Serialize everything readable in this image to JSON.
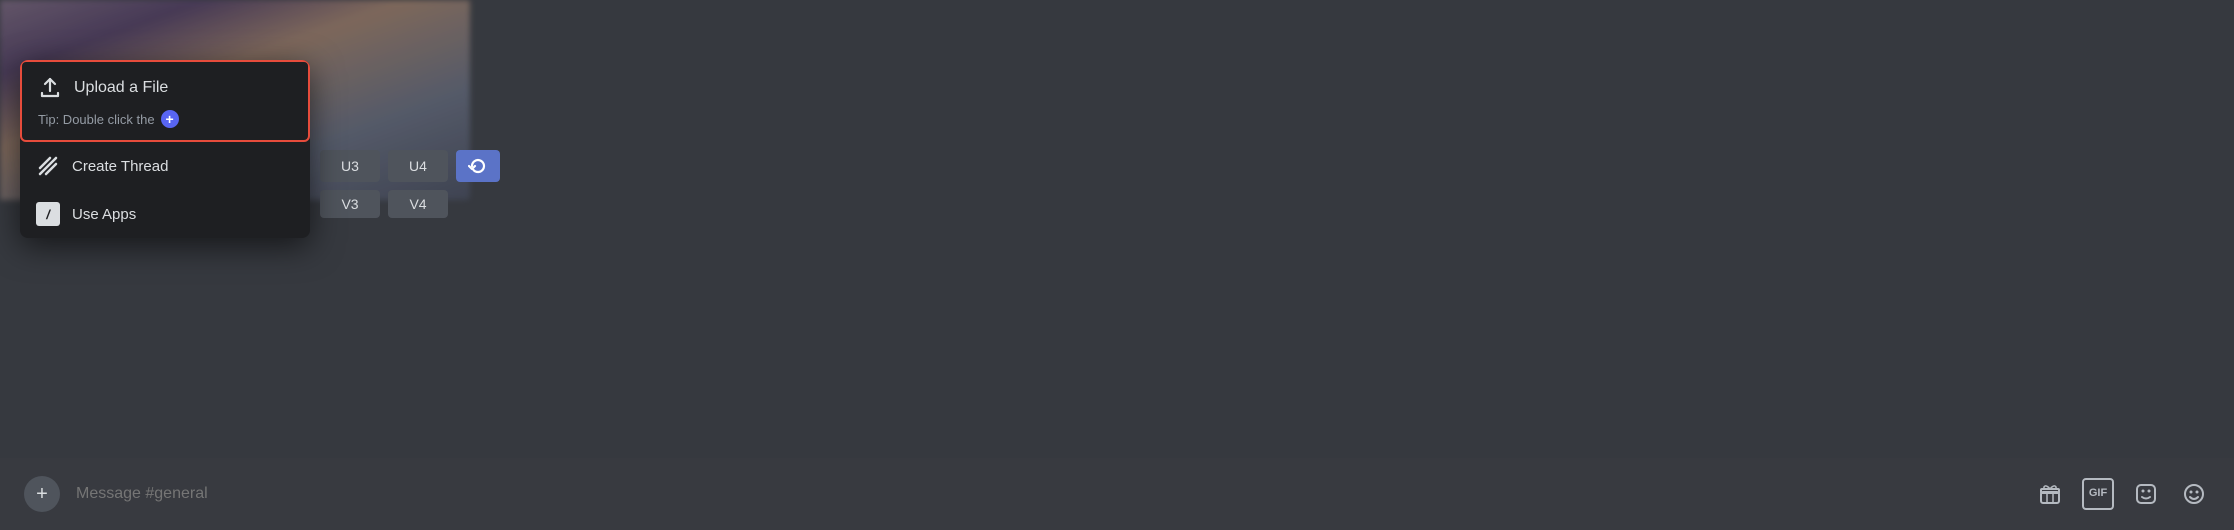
{
  "background": {
    "color": "#36393f"
  },
  "popup_menu": {
    "upload_label": "Upload a File",
    "tip_text": "Tip: Double click the",
    "create_thread_label": "Create Thread",
    "use_apps_label": "Use Apps",
    "highlight_color": "#e74c3c"
  },
  "buttons": {
    "row1": [
      "U3",
      "U4"
    ],
    "row2": [
      "V3",
      "V4"
    ],
    "refresh_label": "↻"
  },
  "chat_bar": {
    "placeholder": "Message #general",
    "icons": [
      "gift-icon",
      "gif-icon",
      "sticker-icon",
      "emoji-icon"
    ]
  }
}
